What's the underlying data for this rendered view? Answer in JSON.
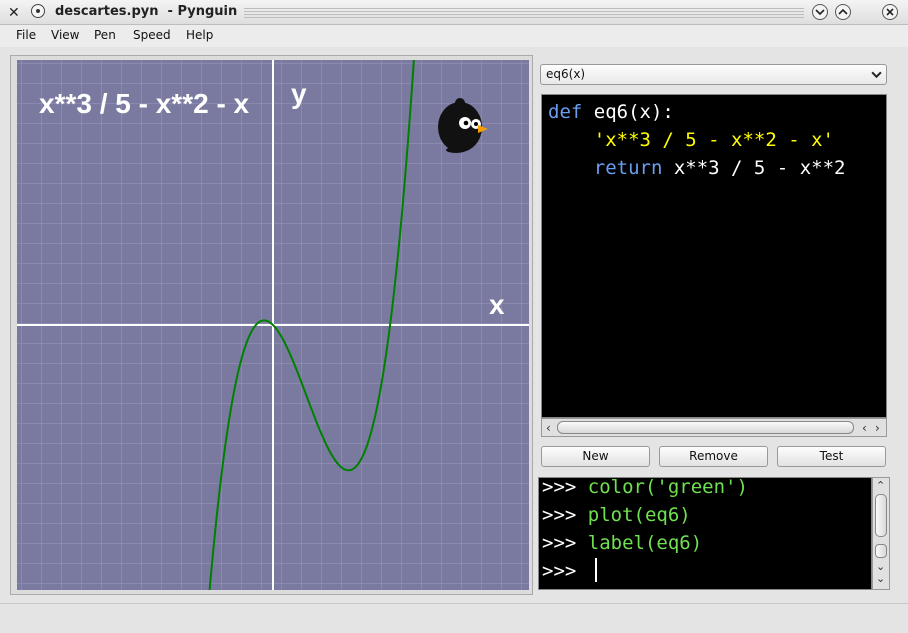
{
  "window": {
    "title": "descartes.pyn  - Pynguin"
  },
  "menu": [
    "File",
    "View",
    "Pen",
    "Speed",
    "Help"
  ],
  "canvas": {
    "label": "x**3 / 5 - x**2 - x",
    "y_axis_label": "y",
    "x_axis_label": "x",
    "background": "#7a7aa0",
    "grid_color": "#9a9abf",
    "axis_color": "#ffffff",
    "curve_color": "#008000",
    "turtle_icon": "penguin-icon"
  },
  "chart_data": {
    "type": "line",
    "title": "x**3 / 5 - x**2 - x",
    "xlabel": "x",
    "ylabel": "y",
    "series": [
      {
        "function": "x**3 / 5 - x**2 - x"
      }
    ]
  },
  "editor": {
    "selected": "eq6(x)",
    "code": {
      "def_kw": "def",
      "signature": "eq6(x):",
      "docstring": "'x**3 / 5 - x**2 - x'",
      "return_kw": "return",
      "return_expr": "x**3 / 5 - x**2"
    },
    "colors": {
      "keyword": "#6a9ef0",
      "string": "#ffff00",
      "text": "#ffffff",
      "background": "#000000"
    }
  },
  "buttons": {
    "new": "New",
    "remove": "Remove",
    "test": "Test"
  },
  "console": {
    "prompt": ">>>",
    "lines": [
      "color('green')",
      "plot(eq6)",
      "label(eq6)",
      ""
    ]
  }
}
